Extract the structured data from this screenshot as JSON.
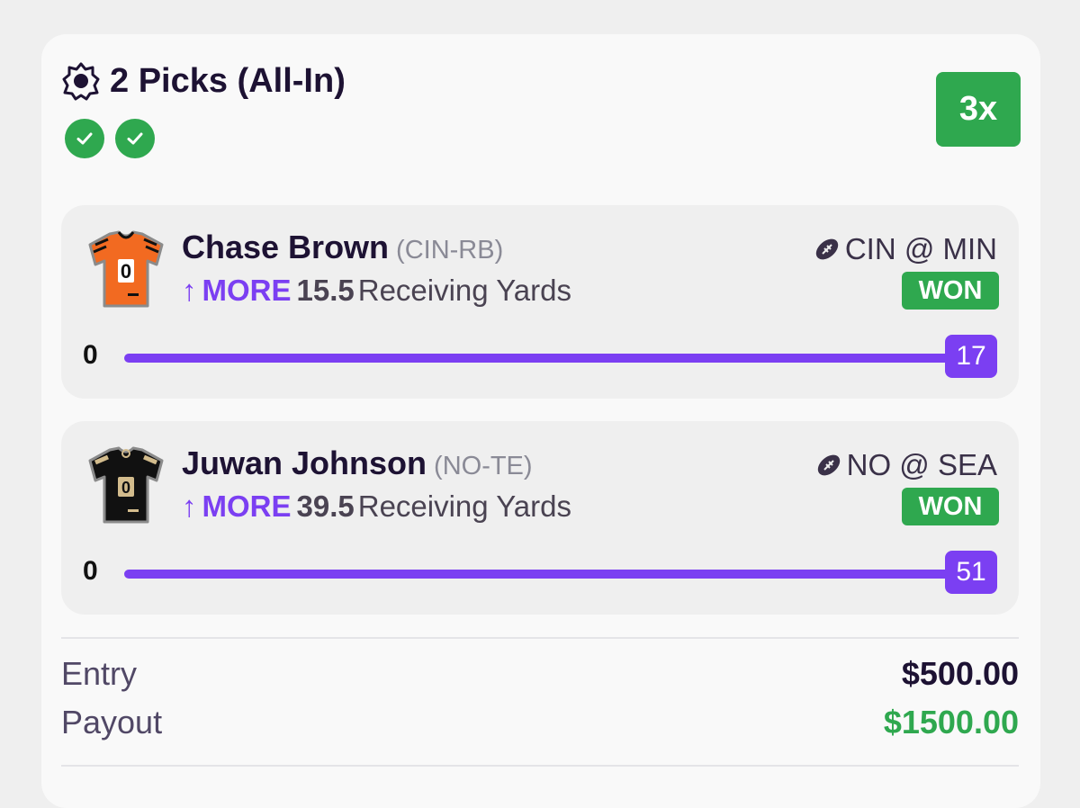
{
  "header": {
    "title": "2 Picks (All-In)",
    "multiplier": "3x",
    "pick_results": [
      "won",
      "won"
    ]
  },
  "picks": [
    {
      "player": "Chase Brown",
      "position": "(CIN-RB)",
      "direction": "MORE",
      "line": "15.5",
      "stat": "Receiving Yards",
      "game": "CIN @ MIN",
      "status": "WON",
      "range_start": "0",
      "result": "17",
      "jersey_color": "#f26a21"
    },
    {
      "player": "Juwan Johnson",
      "position": "(NO-TE)",
      "direction": "MORE",
      "line": "39.5",
      "stat": "Receiving Yards",
      "game": "NO @ SEA",
      "status": "WON",
      "range_start": "0",
      "result": "51",
      "jersey_color": "#111111"
    }
  ],
  "summary": {
    "entry_label": "Entry",
    "entry_value": "$500.00",
    "payout_label": "Payout",
    "payout_value": "$1500.00"
  },
  "colors": {
    "accent": "#7b3ff2",
    "success": "#2fa84f"
  }
}
